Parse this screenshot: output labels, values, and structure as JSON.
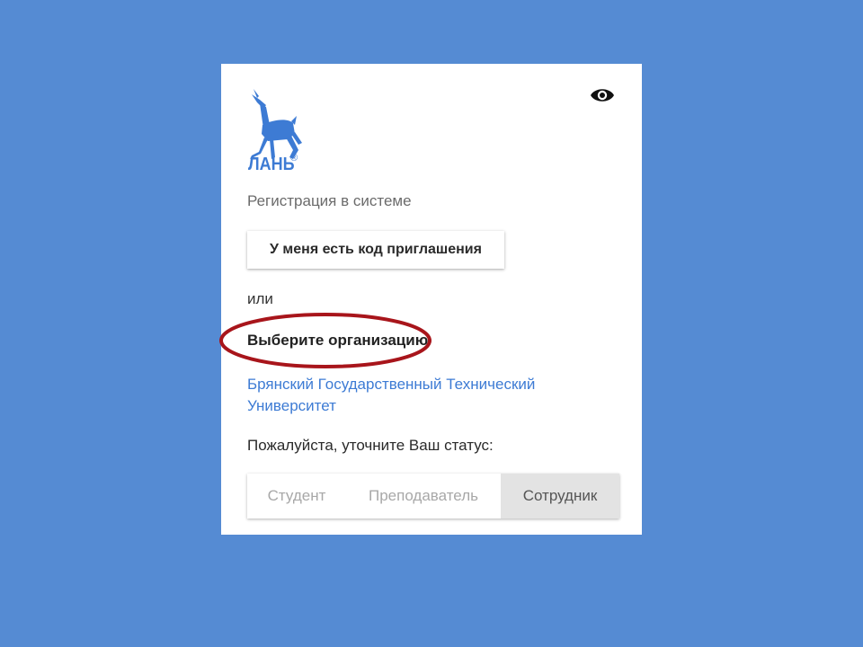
{
  "logo": {
    "text": "ЛАНЬ",
    "registered_mark": "®",
    "color": "#3d7bd4",
    "icon": "deer-icon"
  },
  "header": {
    "subtitle": "Регистрация в системе",
    "visibility_icon": "eye-icon"
  },
  "invite": {
    "button_label": "У меня есть код приглашения"
  },
  "divider": {
    "or_label": "или"
  },
  "organization": {
    "prompt": "Выберите организацию",
    "selected_name": "Брянский Государственный Технический Университет"
  },
  "status": {
    "label": "Пожалуйста, уточните Ваш статус:",
    "options": [
      "Студент",
      "Преподаватель",
      "Сотрудник"
    ],
    "selected": "Сотрудник"
  },
  "colors": {
    "background": "#558bd3",
    "accent": "#3d7bd4",
    "highlight_ellipse": "#a8151b"
  }
}
